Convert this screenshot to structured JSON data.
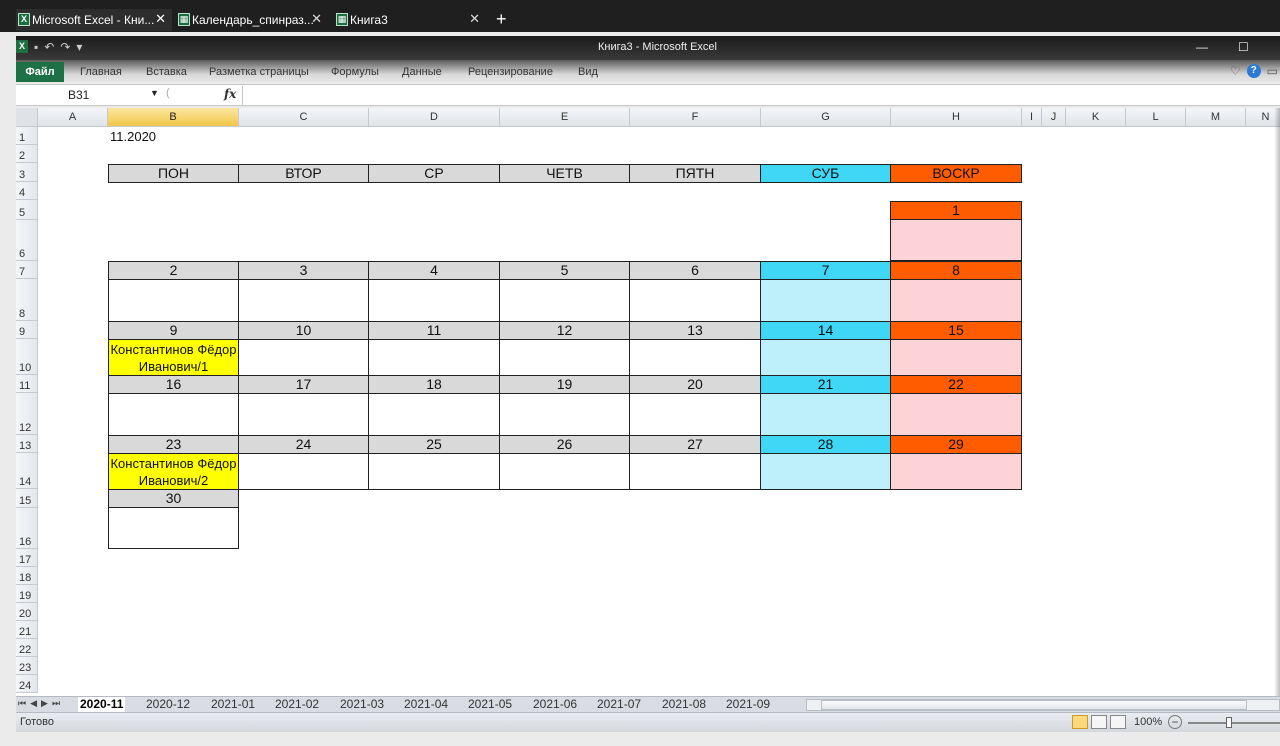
{
  "browser_tabs": [
    {
      "label": "Microsoft Excel - Кни...",
      "active": true
    },
    {
      "label": "Календарь_спинраз...",
      "active": false
    },
    {
      "label": "Книга3",
      "active": false
    }
  ],
  "app": {
    "title": "Книга3 - Microsoft Excel",
    "file_tab": "Файл",
    "ribbon_tabs": [
      "Главная",
      "Вставка",
      "Разметка страницы",
      "Формулы",
      "Данные",
      "Рецензирование",
      "Вид"
    ]
  },
  "formula_bar": {
    "name_box": "B31",
    "fx": "fx",
    "formula": ""
  },
  "columns": [
    "A",
    "B",
    "C",
    "D",
    "E",
    "F",
    "G",
    "H",
    "I",
    "J",
    "K",
    "L",
    "M",
    "N"
  ],
  "selected_column": "B",
  "rows": [
    "1",
    "2",
    "3",
    "4",
    "5",
    "6",
    "7",
    "8",
    "9",
    "10",
    "11",
    "12",
    "13",
    "14",
    "15",
    "16",
    "17",
    "18",
    "19",
    "20",
    "21",
    "22",
    "23",
    "24"
  ],
  "calendar": {
    "month_label": "11.2020",
    "weekdays": [
      "ПОН",
      "ВТОР",
      "СР",
      "ЧЕТВ",
      "ПЯТН",
      "СУБ",
      "ВОСКР"
    ],
    "weeks": [
      [
        "",
        "",
        "",
        "",
        "",
        "",
        "1"
      ],
      [
        "2",
        "3",
        "4",
        "5",
        "6",
        "7",
        "8"
      ],
      [
        "9",
        "10",
        "11",
        "12",
        "13",
        "14",
        "15"
      ],
      [
        "16",
        "17",
        "18",
        "19",
        "20",
        "21",
        "22"
      ],
      [
        "23",
        "24",
        "25",
        "26",
        "27",
        "28",
        "29"
      ],
      [
        "30",
        "",
        "",
        "",
        "",
        "",
        ""
      ]
    ],
    "entries": {
      "week3_mon": "Константинов Фёдор Иванович/1",
      "week5_mon": "Константинов Фёдор Иванович/2"
    },
    "colors": {
      "weekday_header": "#d9d9d9",
      "saturday_header": "#3fd7f5",
      "sunday_header": "#ff5c00",
      "saturday_body": "#bdf0fb",
      "sunday_body": "#fdd3d7",
      "entry_highlight": "#ffff00"
    }
  },
  "sheet_tabs": [
    "2020-11",
    "2020-12",
    "2021-01",
    "2021-02",
    "2021-03",
    "2021-04",
    "2021-05",
    "2021-06",
    "2021-07",
    "2021-08",
    "2021-09"
  ],
  "active_sheet": "2020-11",
  "status": {
    "ready": "Готово",
    "zoom": "100%"
  }
}
